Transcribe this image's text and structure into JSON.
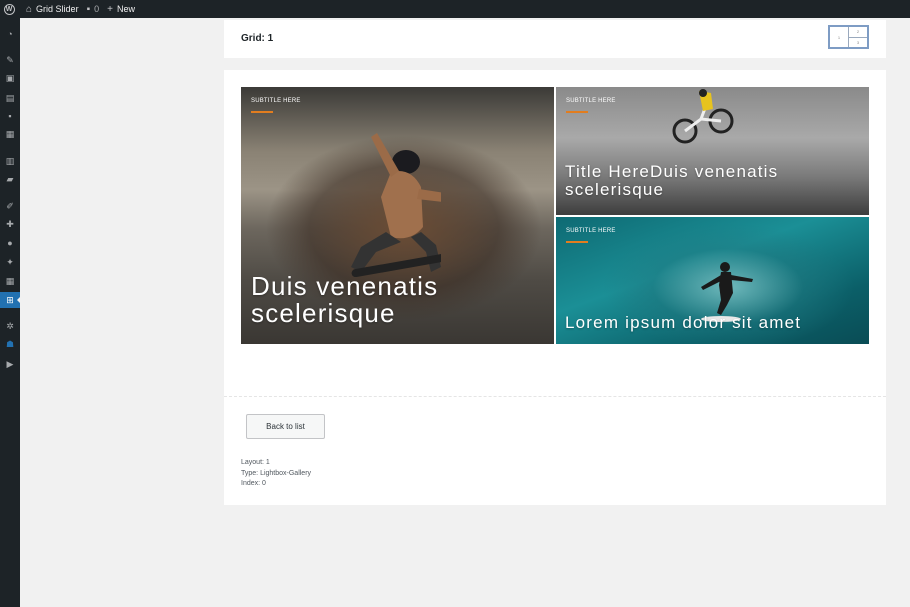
{
  "adminbar": {
    "site_name": "Grid Slider",
    "comments_count": "0",
    "new_label": "New"
  },
  "grid_header": {
    "title": "Grid: 1",
    "layout_thumb": {
      "cell_left": "1",
      "cell_right_top": "2",
      "cell_right_bottom": "3"
    }
  },
  "tiles": [
    {
      "subtitle": "SUBTITLE HERE",
      "title": "Duis venenatis scelerisque"
    },
    {
      "subtitle": "SUBTITLE HERE",
      "title": "Title HereDuis venenatis scelerisque"
    },
    {
      "subtitle": "SUBTITLE HERE",
      "title": "Lorem ipsum dolor sit amet"
    }
  ],
  "back_button_label": "Back to list",
  "meta": {
    "layout": "Layout: 1",
    "type": "Type: Lightbox-Gallery",
    "index": "Index: 0"
  },
  "colors": {
    "adminbar_bg": "#1d2327",
    "accent_blue": "#2271b1",
    "subtitle_bar": "#e27d1f"
  },
  "sidebar_icons": [
    "dashboard-icon",
    "posts-icon",
    "media-icon",
    "pages-icon",
    "comments-icon",
    "calendar-icon",
    "forms-icon",
    "folder-icon",
    "appearance-icon",
    "plugins-icon",
    "users-icon",
    "tools-icon",
    "settings-icon",
    "grid-slider-icon",
    "gear-icon",
    "layers-icon",
    "play-icon"
  ]
}
